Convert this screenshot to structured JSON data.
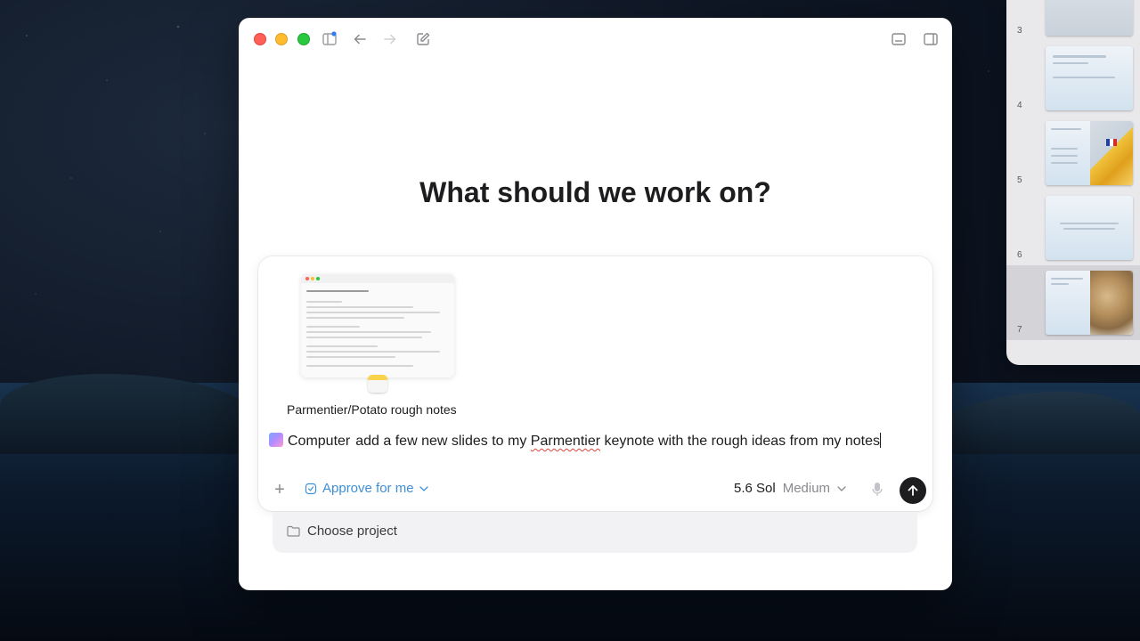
{
  "window": {
    "headline": "What should we work on?"
  },
  "toolbar": {
    "icons": [
      "sidebar-icon",
      "back-arrow-icon",
      "forward-arrow-icon",
      "compose-icon",
      "minimize-panel-icon",
      "sidebar-right-icon"
    ]
  },
  "attachment": {
    "title": "Parmentier/Potato rough notes",
    "app_icon": "notes-app-icon"
  },
  "composer": {
    "agent_chip": "Computer",
    "prompt_part1": "add a few new slides to my ",
    "prompt_misspelled": "Parmentier",
    "prompt_part2": " keynote with the rough ideas from my notes",
    "approval_mode": "Approve for me",
    "model": "5.6 Sol",
    "effort": "Medium"
  },
  "project": {
    "label": "Choose project"
  },
  "keynote_panel": {
    "slides": [
      {
        "number": "3"
      },
      {
        "number": "4"
      },
      {
        "number": "5"
      },
      {
        "number": "6"
      },
      {
        "number": "7",
        "selected": true
      }
    ]
  },
  "colors": {
    "accent_link": "#3f8fd6",
    "send_button": "#1d1d1f",
    "close": "#fe5f57",
    "minimize": "#febc2e",
    "zoom": "#28c840"
  }
}
